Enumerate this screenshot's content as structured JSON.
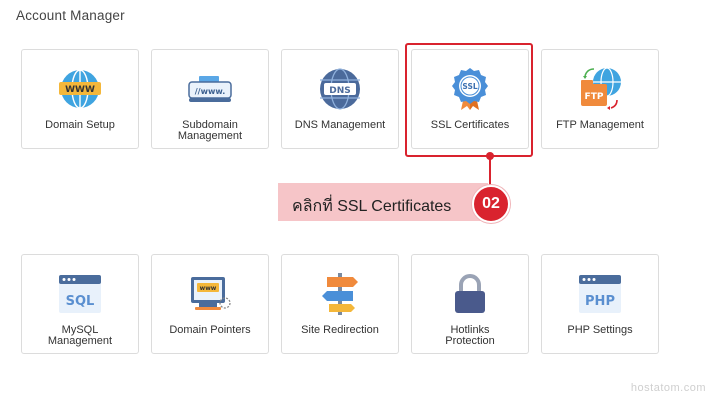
{
  "section_title": "Account Manager",
  "row1": [
    {
      "icon": "globe-www-icon",
      "label1": "Domain Setup",
      "label2": ""
    },
    {
      "icon": "subdomain-icon",
      "label1": "Subdomain",
      "label2": "Management"
    },
    {
      "icon": "dns-globe-icon",
      "label1": "DNS Management",
      "label2": ""
    },
    {
      "icon": "ssl-badge-icon",
      "label1": "SSL Certificates",
      "label2": ""
    },
    {
      "icon": "ftp-icon",
      "label1": "FTP Management",
      "label2": ""
    }
  ],
  "row2": [
    {
      "icon": "sql-window-icon",
      "label1": "MySQL",
      "label2": "Management"
    },
    {
      "icon": "domain-pointer-icon",
      "label1": "Domain Pointers",
      "label2": ""
    },
    {
      "icon": "signpost-icon",
      "label1": "Site Redirection",
      "label2": ""
    },
    {
      "icon": "padlock-icon",
      "label1": "Hotlinks",
      "label2": "Protection"
    },
    {
      "icon": "php-window-icon",
      "label1": "PHP Settings",
      "label2": ""
    }
  ],
  "callout": {
    "text": "คลิกที่ SSL Certificates",
    "step": "02"
  },
  "watermark": "hostatom.com",
  "colors": {
    "highlight": "#d9232e",
    "callout_bg": "#f6c5c8"
  }
}
